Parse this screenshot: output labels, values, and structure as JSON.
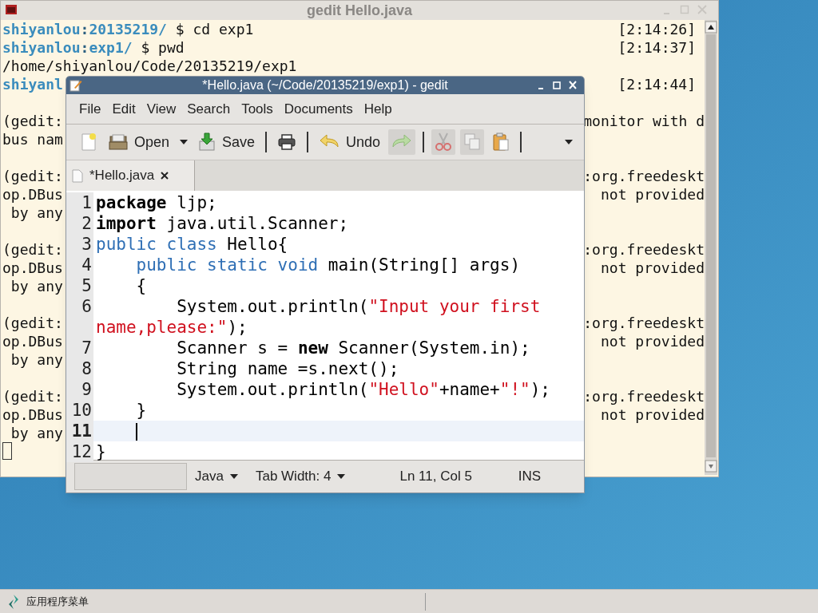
{
  "terminal": {
    "title": "gedit Hello.java",
    "lines": [
      {
        "kind": "prompt",
        "user": "shiyanlou",
        "sep": ":",
        "dir": "20135219/",
        "command": " $ cd exp1",
        "time": "[2:14:26]"
      },
      {
        "kind": "prompt",
        "user": "shiyanlou",
        "sep": ":",
        "dir": "exp1/",
        "command": " $ pwd",
        "time": "[2:14:37]"
      },
      {
        "kind": "output",
        "text": "/home/shiyanlou/Code/20135219/exp1"
      },
      {
        "kind": "prompt",
        "user": "shiyanl",
        "time": "[2:14:44]"
      },
      {
        "kind": "blank"
      },
      {
        "kind": "output",
        "text": "(gedit:",
        "right": "monitor with d"
      },
      {
        "kind": "output",
        "text": "bus nam"
      },
      {
        "kind": "blank"
      },
      {
        "kind": "output",
        "text": "(gedit:",
        "right": ":org.freedeskt"
      },
      {
        "kind": "output",
        "text": "op.DBus",
        "right": "not provided"
      },
      {
        "kind": "output",
        "text": " by any"
      },
      {
        "kind": "blank"
      },
      {
        "kind": "output",
        "text": "(gedit:",
        "right": ":org.freedeskt"
      },
      {
        "kind": "output",
        "text": "op.DBus",
        "right": "not provided"
      },
      {
        "kind": "output",
        "text": " by any"
      },
      {
        "kind": "blank"
      },
      {
        "kind": "output",
        "text": "(gedit:",
        "right": ":org.freedeskt"
      },
      {
        "kind": "output",
        "text": "op.DBus",
        "right": "not provided"
      },
      {
        "kind": "output",
        "text": " by any"
      },
      {
        "kind": "blank"
      },
      {
        "kind": "output",
        "text": "(gedit:",
        "right": ":org.freedeskt"
      },
      {
        "kind": "output",
        "text": "op.DBus",
        "right": "not provided"
      },
      {
        "kind": "output",
        "text": " by any"
      },
      {
        "kind": "cursor"
      }
    ]
  },
  "gedit": {
    "title": "*Hello.java (~/Code/20135219/exp1) - gedit",
    "menu": [
      "File",
      "Edit",
      "View",
      "Search",
      "Tools",
      "Documents",
      "Help"
    ],
    "toolbar": [
      {
        "kind": "button",
        "disabled": false
      },
      {
        "kind": "button",
        "label": "Open",
        "disabled": false
      },
      {
        "kind": "dropdown"
      },
      {
        "kind": "button",
        "label": "Save",
        "disabled": false
      },
      {
        "kind": "separator"
      },
      {
        "kind": "button",
        "disabled": false
      },
      {
        "kind": "separator"
      },
      {
        "kind": "button",
        "label": "Undo",
        "disabled": false
      },
      {
        "kind": "button",
        "disabled": true
      },
      {
        "kind": "separator"
      },
      {
        "kind": "button",
        "disabled": true
      },
      {
        "kind": "button",
        "disabled": true
      },
      {
        "kind": "button",
        "disabled": false
      },
      {
        "kind": "separator"
      },
      {
        "kind": "overflow"
      }
    ],
    "tabs": [
      {
        "label": "*Hello.java",
        "selected": true
      }
    ],
    "lines": [
      {
        "number": "1",
        "current": false,
        "tokens": [
          {
            "kind": "keyword",
            "text": "package"
          },
          {
            "kind": "plain",
            "text": " ljp;"
          }
        ]
      },
      {
        "number": "2",
        "current": false,
        "tokens": [
          {
            "kind": "keyword",
            "text": "import"
          },
          {
            "kind": "plain",
            "text": " java.util.Scanner;"
          }
        ]
      },
      {
        "number": "3",
        "current": false,
        "tokens": [
          {
            "kind": "type",
            "text": "public"
          },
          {
            "kind": "type",
            "text": " class"
          },
          {
            "kind": "plain",
            "text": " Hello{"
          }
        ]
      },
      {
        "number": "4",
        "current": false,
        "tokens": [
          {
            "kind": "type",
            "text": "    public"
          },
          {
            "kind": "type",
            "text": " static"
          },
          {
            "kind": "type",
            "text": " void"
          },
          {
            "kind": "plain",
            "text": " main(String[] args)"
          }
        ]
      },
      {
        "number": "5",
        "current": false,
        "tokens": [
          {
            "kind": "plain",
            "text": "    {"
          }
        ]
      },
      {
        "number": "6",
        "current": false,
        "tokens": [
          {
            "kind": "plain",
            "text": "        System.out.println("
          },
          {
            "kind": "string",
            "text": "\"Input your first name,please:\""
          },
          {
            "kind": "plain",
            "text": ");"
          }
        ]
      },
      {
        "number": "7",
        "current": false,
        "tokens": [
          {
            "kind": "plain",
            "text": "        Scanner s = "
          },
          {
            "kind": "keyword",
            "text": "new"
          },
          {
            "kind": "plain",
            "text": " Scanner(System.in);"
          }
        ]
      },
      {
        "number": "8",
        "current": false,
        "tokens": [
          {
            "kind": "plain",
            "text": "        String name =s.next();"
          }
        ]
      },
      {
        "number": "9",
        "current": false,
        "tokens": [
          {
            "kind": "plain",
            "text": "        System.out.println("
          },
          {
            "kind": "string",
            "text": "\"Hello\""
          },
          {
            "kind": "plain",
            "text": "+name+"
          },
          {
            "kind": "string",
            "text": "\"!\""
          },
          {
            "kind": "plain",
            "text": ");"
          }
        ]
      },
      {
        "number": "10",
        "current": false,
        "tokens": [
          {
            "kind": "plain",
            "text": "    }"
          }
        ]
      },
      {
        "number": "11",
        "current": true
      },
      {
        "number": "12",
        "current": false,
        "tokens": [
          {
            "kind": "plain",
            "text": "}"
          }
        ]
      }
    ],
    "status_bar": {
      "language": "Java",
      "tab_width": "Tab Width: 4",
      "position": "Ln 11, Col 5",
      "mode": "INS"
    }
  },
  "taskbar": {
    "menu_label": "应用程序菜单"
  }
}
